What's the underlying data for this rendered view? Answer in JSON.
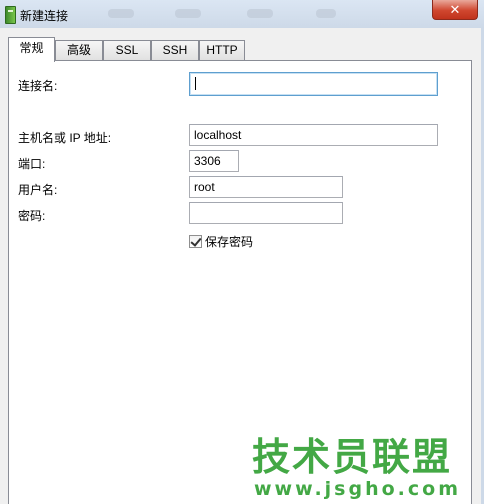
{
  "window": {
    "title": "新建连接",
    "close_label": "✕"
  },
  "tabs": [
    {
      "label": "常规"
    },
    {
      "label": "高级"
    },
    {
      "label": "SSL"
    },
    {
      "label": "SSH"
    },
    {
      "label": "HTTP"
    }
  ],
  "form": {
    "connection_name": {
      "label": "连接名:",
      "value": ""
    },
    "host": {
      "label": "主机名或 IP 地址:",
      "value": "localhost"
    },
    "port": {
      "label": "端口:",
      "value": "3306"
    },
    "username": {
      "label": "用户名:",
      "value": "root"
    },
    "password": {
      "label": "密码:",
      "value": ""
    },
    "save_password": {
      "label": "保存密码",
      "checked": true
    }
  },
  "watermark": {
    "title": "技术员联盟",
    "url": "www.jsgho.com"
  },
  "colors": {
    "watermark": "#43a845",
    "close_button": "#c0321c",
    "focus_border": "#5e9fcf"
  }
}
